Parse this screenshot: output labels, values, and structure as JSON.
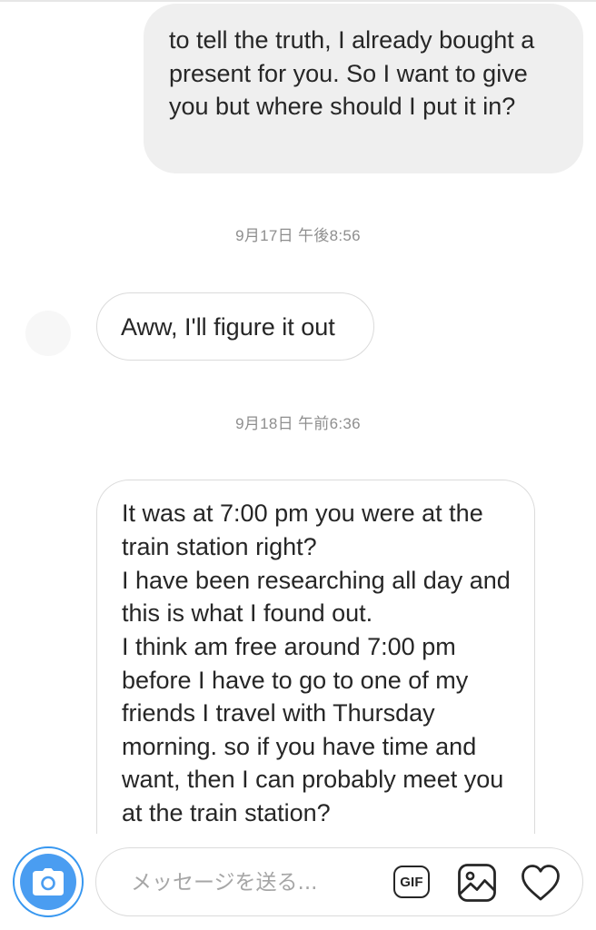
{
  "conversation": {
    "sent_message": {
      "text": "to tell the truth, I already bought a present for you. So I want to give you but where should I put it in?"
    },
    "timestamp_1": "9月17日 午後8:56",
    "received_message_1": {
      "text": "Aww, I'll figure it out"
    },
    "timestamp_2": "9月18日 午前6:36",
    "received_message_2": {
      "paragraphs": [
        "It was at 7:00 pm you were at the train station right?",
        "I have been researching all day and this is what I found out.",
        " I think am free around 7:00 pm before I have to go to one of my friends I travel with Thursday morning. so if you have time and want, then I can probably meet you at the train station?"
      ]
    }
  },
  "composer": {
    "placeholder": "メッセージを送る...",
    "camera_icon": "camera-icon",
    "gif_label": "GIF",
    "image_icon": "image-icon",
    "heart_icon": "heart-icon",
    "accent_color": "#3797f0"
  }
}
